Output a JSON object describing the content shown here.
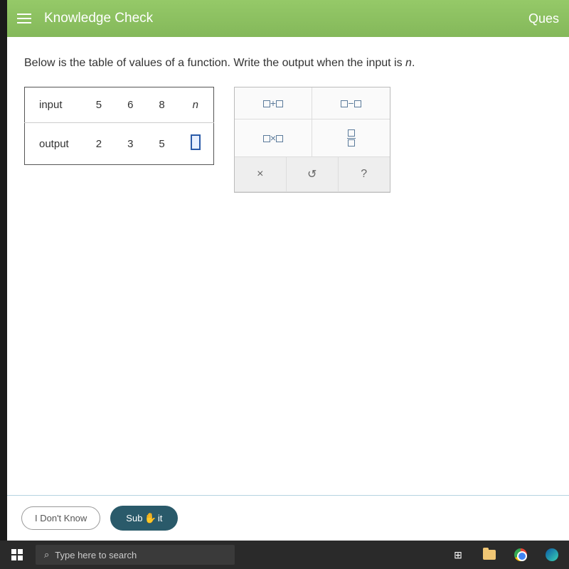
{
  "header": {
    "title": "Knowledge Check",
    "right_label": "Ques"
  },
  "question": {
    "prompt_prefix": "Below is the table of values of a function. Write the output when the input is ",
    "prompt_var": "n",
    "prompt_suffix": "."
  },
  "table": {
    "row1_label": "input",
    "row2_label": "output",
    "inputs": [
      "5",
      "6",
      "8",
      "n"
    ],
    "outputs": [
      "2",
      "3",
      "5",
      ""
    ]
  },
  "tools": {
    "add": "□+□",
    "sub": "□−□",
    "mul": "□×□",
    "clear": "×",
    "undo": "↺",
    "help": "?"
  },
  "actions": {
    "dont_know": "I Don't Know",
    "submit_a": "Sub",
    "submit_b": "it"
  },
  "taskbar": {
    "search_placeholder": "Type here to search"
  },
  "chart_data": {
    "type": "table",
    "columns": [
      "input",
      "output"
    ],
    "rows": [
      {
        "input": 5,
        "output": 2
      },
      {
        "input": 6,
        "output": 3
      },
      {
        "input": 8,
        "output": 5
      },
      {
        "input": "n",
        "output": null
      }
    ],
    "title": "Function table of values"
  }
}
